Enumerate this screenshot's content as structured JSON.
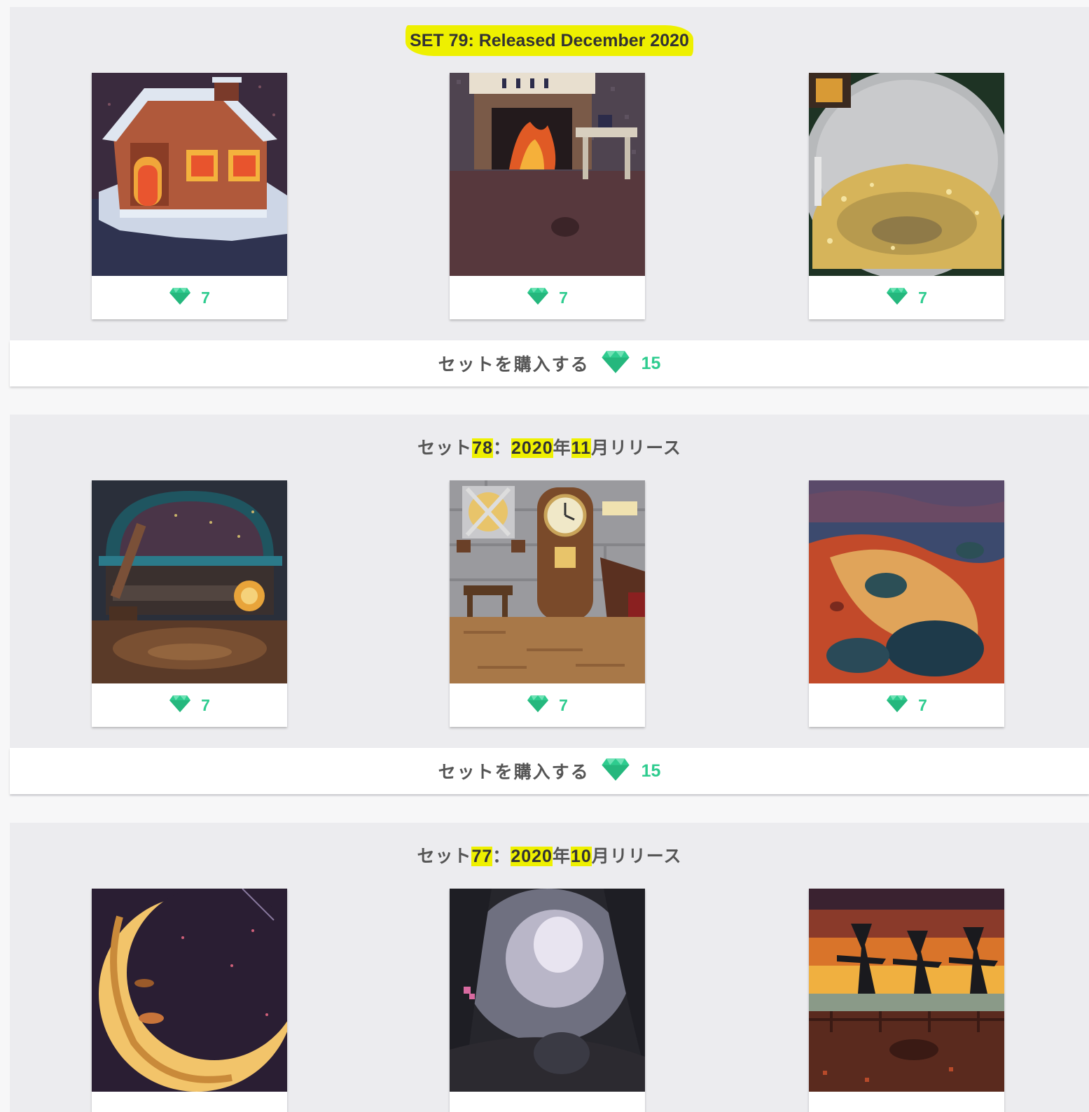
{
  "sets": [
    {
      "title_parts": [
        {
          "text": "SET 79: Released December 2020",
          "highlight": true
        }
      ],
      "items": [
        {
          "name": "gingerbread house",
          "price": "7"
        },
        {
          "name": "fireplace room",
          "price": "7"
        },
        {
          "name": "snow globe",
          "price": "7"
        }
      ],
      "buy_label": "セットを購入する",
      "buy_price": "15"
    },
    {
      "title_parts": [
        {
          "text": "セット",
          "highlight": false
        },
        {
          "text": "78",
          "highlight": true
        },
        {
          "text": "：",
          "highlight": false
        },
        {
          "text": "2020",
          "highlight": true
        },
        {
          "text": "年",
          "highlight": false
        },
        {
          "text": "11",
          "highlight": true
        },
        {
          "text": "月リリース",
          "highlight": false
        }
      ],
      "items": [
        {
          "name": "wizard window",
          "price": "7"
        },
        {
          "name": "grandfather clock room",
          "price": "7"
        },
        {
          "name": "lava planet",
          "price": "7"
        }
      ],
      "buy_label": "セットを購入する",
      "buy_price": "15"
    },
    {
      "title_parts": [
        {
          "text": "セット",
          "highlight": false
        },
        {
          "text": "77",
          "highlight": true
        },
        {
          "text": "：",
          "highlight": false
        },
        {
          "text": "2020",
          "highlight": true
        },
        {
          "text": "年",
          "highlight": false
        },
        {
          "text": "10",
          "highlight": true
        },
        {
          "text": "月リリース",
          "highlight": false
        }
      ],
      "items": [
        {
          "name": "crescent moon",
          "price": ""
        },
        {
          "name": "misty forest",
          "price": ""
        },
        {
          "name": "sunset scarecrows",
          "price": ""
        }
      ]
    }
  ],
  "colors": {
    "gem": "#2ecc8f",
    "highlight": "#eef000",
    "set_background": "#ececef"
  },
  "icons": {
    "price": "gem-icon"
  }
}
